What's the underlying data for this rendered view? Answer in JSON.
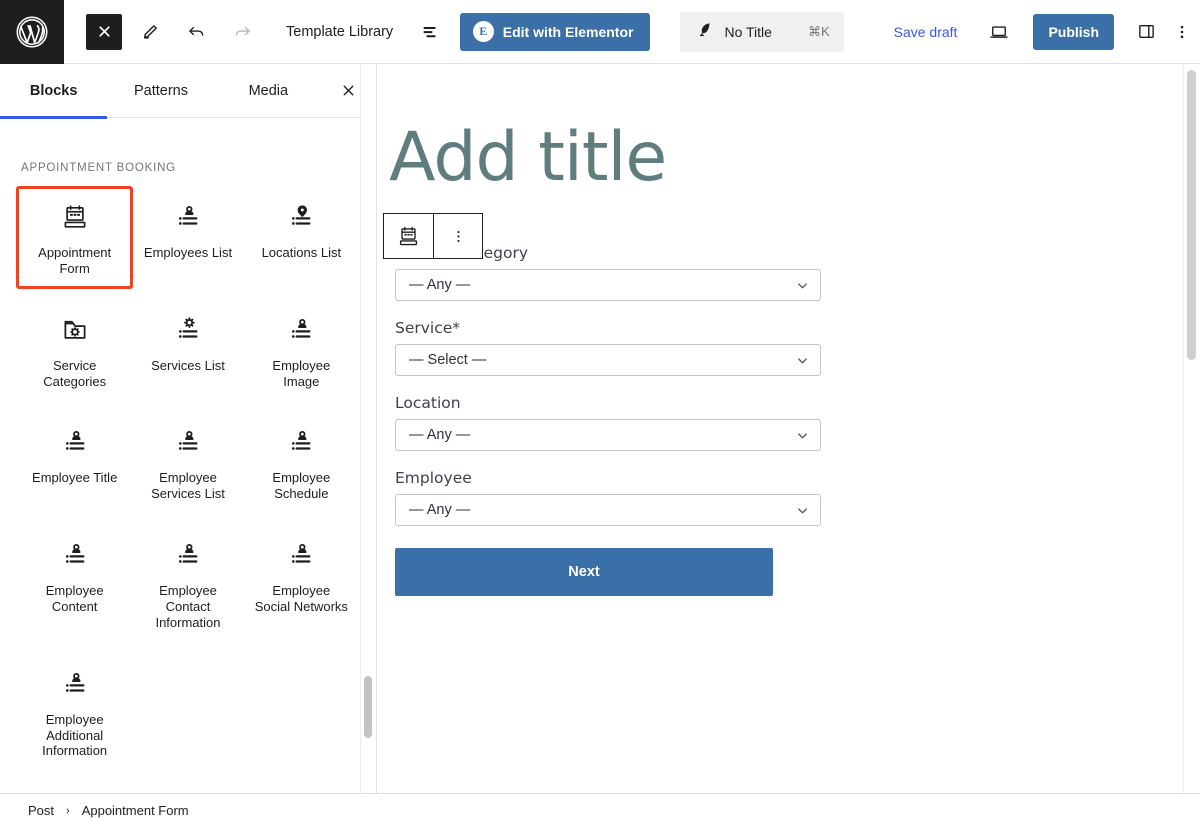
{
  "topbar": {
    "logo_icon": "wordpress-logo-icon",
    "close_inserter_icon": "close-x-icon",
    "edit_icon": "pencil-edit-icon",
    "undo_icon": "undo-arrow-icon",
    "redo_icon": "redo-arrow-icon",
    "template_library_label": "Template Library",
    "list_view_icon": "list-view-icon",
    "elementor_label": "Edit with Elementor",
    "elementor_badge": "E",
    "document_title": "No Title",
    "document_shortcut": "⌘K",
    "document_icon": "quill-pen-icon",
    "save_draft_label": "Save draft",
    "preview_icon": "laptop-preview-icon",
    "publish_label": "Publish",
    "settings_sidebar_icon": "sidebar-panel-icon",
    "options_icon": "vertical-dots-icon",
    "accent_blue": "#3b6fa8",
    "link_blue": "#3858e9"
  },
  "inserter": {
    "tabs": [
      {
        "label": "Blocks",
        "active": true
      },
      {
        "label": "Patterns",
        "active": false
      },
      {
        "label": "Media",
        "active": false
      }
    ],
    "close_icon": "close-x-icon",
    "section_title": "APPOINTMENT BOOKING",
    "highlight_color": "#ef4423",
    "blocks": [
      {
        "label": "Appointment Form",
        "icon": "calendar-form-icon",
        "highlighted": true
      },
      {
        "label": "Employees List",
        "icon": "person-list-icon",
        "highlighted": false
      },
      {
        "label": "Locations List",
        "icon": "map-pin-list-icon",
        "highlighted": false
      },
      {
        "label": "Service Categories",
        "icon": "folder-gear-icon",
        "highlighted": false
      },
      {
        "label": "Services List",
        "icon": "gear-list-icon",
        "highlighted": false
      },
      {
        "label": "Employee Image",
        "icon": "person-list-icon",
        "highlighted": false
      },
      {
        "label": "Employee Title",
        "icon": "person-list-icon",
        "highlighted": false
      },
      {
        "label": "Employee Services List",
        "icon": "person-list-icon",
        "highlighted": false
      },
      {
        "label": "Employee Schedule",
        "icon": "person-list-icon",
        "highlighted": false
      },
      {
        "label": "Employee Content",
        "icon": "person-list-icon",
        "highlighted": false
      },
      {
        "label": "Employee Contact Information",
        "icon": "person-list-icon",
        "highlighted": false
      },
      {
        "label": "Employee Social Networks",
        "icon": "person-list-icon",
        "highlighted": false
      },
      {
        "label": "Employee Additional Information",
        "icon": "person-list-icon",
        "highlighted": false
      }
    ]
  },
  "editor": {
    "title_placeholder": "Add title",
    "block_toolbar": {
      "block_icon": "calendar-form-icon",
      "more_options_icon": "vertical-dots-icon"
    },
    "form": {
      "fields": [
        {
          "label": "Service Category",
          "required": false,
          "value": "— Any —"
        },
        {
          "label": "Service",
          "required": true,
          "value": "— Select —"
        },
        {
          "label": "Location",
          "required": false,
          "value": "— Any —"
        },
        {
          "label": "Employee",
          "required": false,
          "value": "— Any —"
        }
      ],
      "required_marker": "*",
      "chevron_icon": "chevron-down-icon",
      "submit_label": "Next",
      "submit_color": "#3b6fa8"
    }
  },
  "breadcrumb": {
    "items": [
      "Post",
      "Appointment Form"
    ],
    "separator": "›"
  }
}
